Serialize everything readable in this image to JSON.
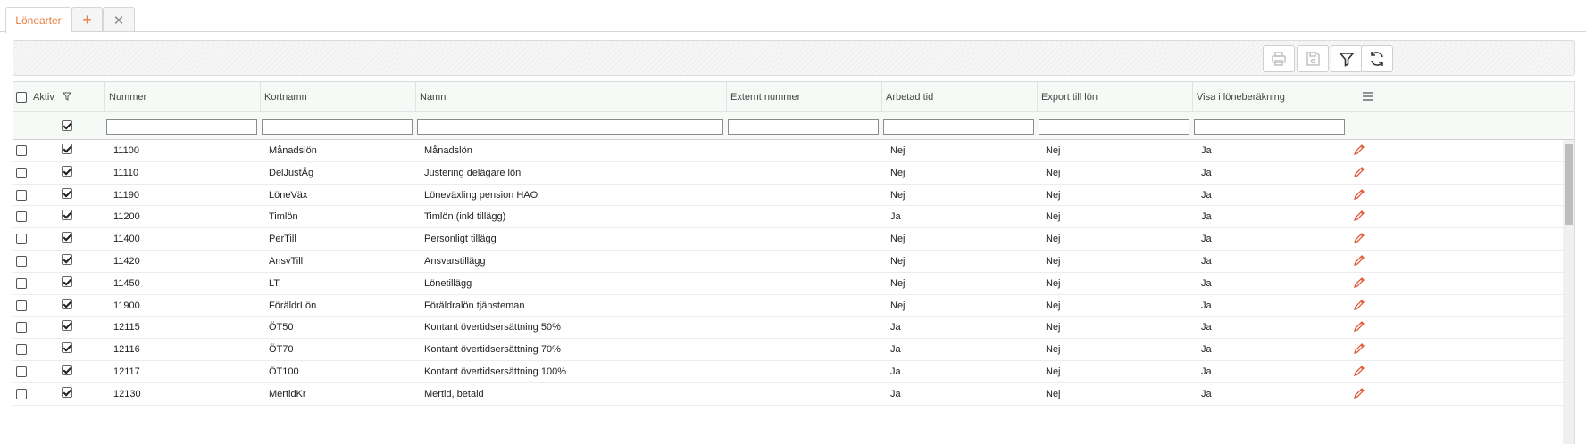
{
  "tabs": [
    {
      "label": "Lönearter",
      "active": true
    }
  ],
  "tab_actions": {
    "add_symbol": "+",
    "close_symbol": "✕"
  },
  "toolbar": {
    "buttons": [
      {
        "name": "print",
        "icon": "printer-icon",
        "enabled": false
      },
      {
        "name": "save",
        "icon": "save-icon",
        "enabled": false
      },
      {
        "name": "filter",
        "icon": "filter-icon",
        "enabled": true
      },
      {
        "name": "refresh",
        "icon": "refresh-icon",
        "enabled": true
      }
    ]
  },
  "grid": {
    "columns": [
      "Aktiv",
      "Nummer",
      "Kortnamn",
      "Namn",
      "Externt nummer",
      "Arbetad tid",
      "Export till lön",
      "Visa i löneberäkning"
    ],
    "aktiv_filter_checked": true,
    "rows": [
      {
        "aktiv": true,
        "nummer": "11100",
        "kortnamn": "Månadslön",
        "namn": "Månadslön",
        "externt": "",
        "arbetad": "Nej",
        "export": "Nej",
        "visa": "Ja"
      },
      {
        "aktiv": true,
        "nummer": "11110",
        "kortnamn": "DelJustÄg",
        "namn": "Justering delägare lön",
        "externt": "",
        "arbetad": "Nej",
        "export": "Nej",
        "visa": "Ja"
      },
      {
        "aktiv": true,
        "nummer": "11190",
        "kortnamn": "LöneVäx",
        "namn": "Löneväxling pension HAO",
        "externt": "",
        "arbetad": "Nej",
        "export": "Nej",
        "visa": "Ja"
      },
      {
        "aktiv": true,
        "nummer": "11200",
        "kortnamn": "Timlön",
        "namn": "Timlön (inkl tillägg)",
        "externt": "",
        "arbetad": "Ja",
        "export": "Nej",
        "visa": "Ja"
      },
      {
        "aktiv": true,
        "nummer": "11400",
        "kortnamn": "PerTill",
        "namn": "Personligt tillägg",
        "externt": "",
        "arbetad": "Nej",
        "export": "Nej",
        "visa": "Ja"
      },
      {
        "aktiv": true,
        "nummer": "11420",
        "kortnamn": "AnsvTill",
        "namn": "Ansvarstillägg",
        "externt": "",
        "arbetad": "Nej",
        "export": "Nej",
        "visa": "Ja"
      },
      {
        "aktiv": true,
        "nummer": "11450",
        "kortnamn": "LT",
        "namn": "Lönetillägg",
        "externt": "",
        "arbetad": "Nej",
        "export": "Nej",
        "visa": "Ja"
      },
      {
        "aktiv": true,
        "nummer": "11900",
        "kortnamn": "FöräldrLön",
        "namn": "Föräldralön tjänsteman",
        "externt": "",
        "arbetad": "Nej",
        "export": "Nej",
        "visa": "Ja"
      },
      {
        "aktiv": true,
        "nummer": "12115",
        "kortnamn": "ÖT50",
        "namn": "Kontant övertidsersättning 50%",
        "externt": "",
        "arbetad": "Ja",
        "export": "Nej",
        "visa": "Ja"
      },
      {
        "aktiv": true,
        "nummer": "12116",
        "kortnamn": "ÖT70",
        "namn": "Kontant övertidsersättning 70%",
        "externt": "",
        "arbetad": "Ja",
        "export": "Nej",
        "visa": "Ja"
      },
      {
        "aktiv": true,
        "nummer": "12117",
        "kortnamn": "ÖT100",
        "namn": "Kontant övertidsersättning 100%",
        "externt": "",
        "arbetad": "Ja",
        "export": "Nej",
        "visa": "Ja"
      },
      {
        "aktiv": true,
        "nummer": "12130",
        "kortnamn": "MertidKr",
        "namn": "Mertid, betald",
        "externt": "",
        "arbetad": "Ja",
        "export": "Nej",
        "visa": "Ja"
      }
    ]
  },
  "colors": {
    "accent": "#e87d3e",
    "edit_icon": "#e05a3a",
    "header_bg": "#f6faf6"
  }
}
